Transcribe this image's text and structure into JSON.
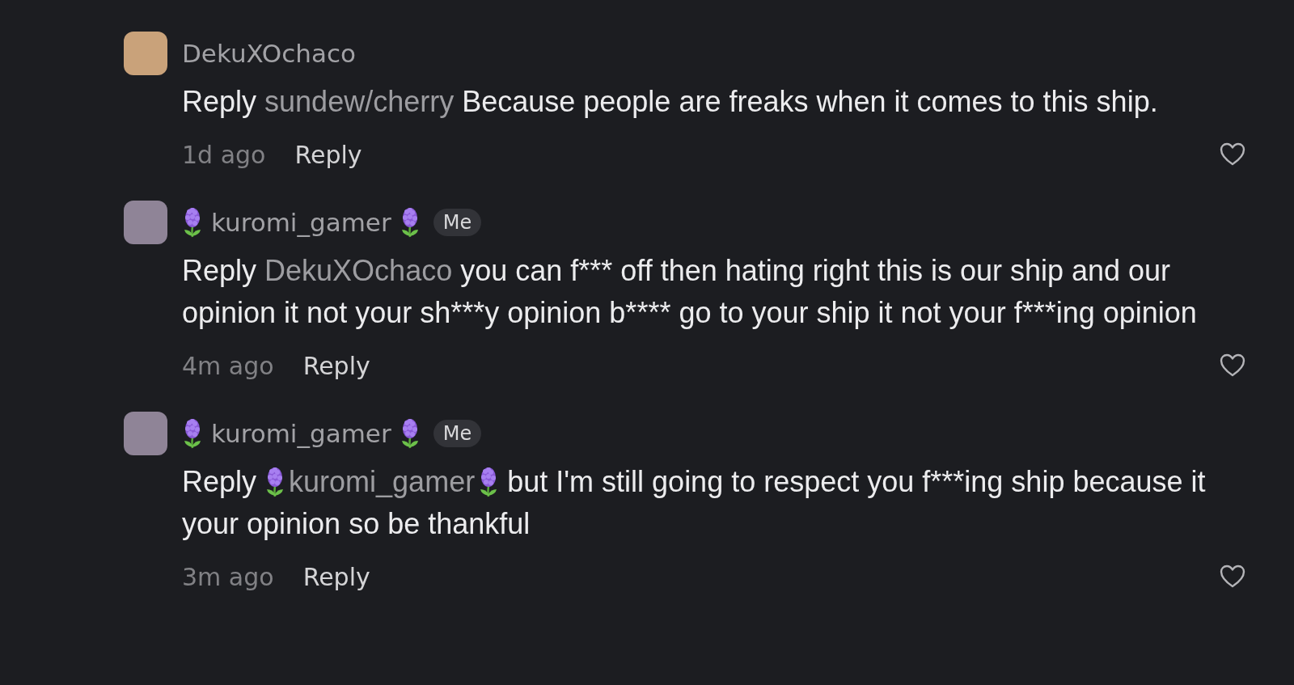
{
  "comments": [
    {
      "author": "DekuXOchaco",
      "author_flowers": false,
      "prefix": "Reply",
      "mention": "sundew/cherry",
      "mention_flowers": false,
      "text": "Because people are freaks when it comes to this ship.",
      "time": "1d ago",
      "reply_label": "Reply",
      "liked": false
    },
    {
      "author": "kuromi_gamer",
      "author_flowers": true,
      "me_label": "Me",
      "prefix": "Reply",
      "mention": "DekuXOchaco",
      "mention_flowers": false,
      "text": "you can f*** off then hating right this is our ship and our opinion it not your sh***y opinion b**** go to your ship it not your f***ing opinion",
      "time": "4m ago",
      "reply_label": "Reply",
      "liked": false
    },
    {
      "author": "kuromi_gamer",
      "author_flowers": true,
      "me_label": "Me",
      "prefix": "Reply",
      "mention": "kuromi_gamer",
      "mention_flowers": true,
      "text": "but I'm still going to respect you f***ing ship because it your opinion so be thankful",
      "time": "3m ago",
      "reply_label": "Reply",
      "liked": false
    }
  ]
}
